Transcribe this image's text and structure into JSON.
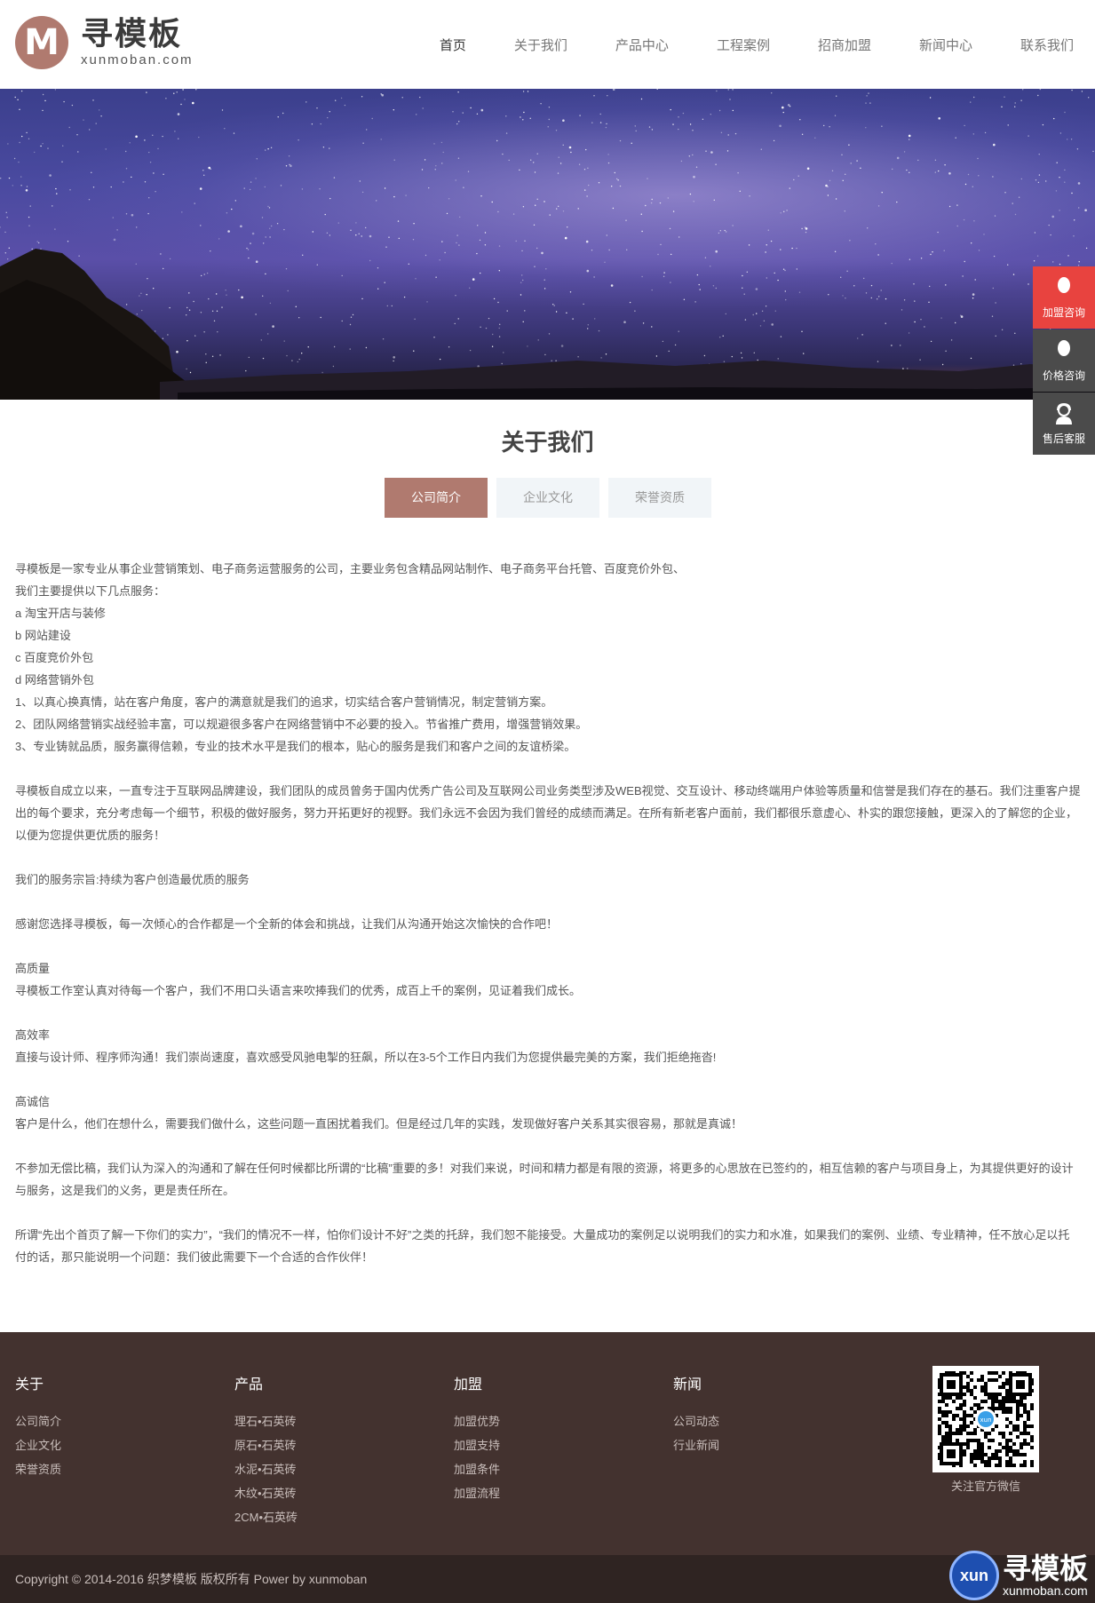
{
  "logo": {
    "mark": "M",
    "name": "寻模板",
    "domain": "xunmoban.com"
  },
  "nav": [
    "首页",
    "关于我们",
    "产品中心",
    "工程案例",
    "招商加盟",
    "新闻中心",
    "联系我们"
  ],
  "side_float": [
    "加盟咨询",
    "价格咨询",
    "售后客服"
  ],
  "about": {
    "title": "关于我们",
    "tabs": [
      "公司简介",
      "企业文化",
      "荣誉资质"
    ],
    "paragraphs": [
      "寻模板是一家专业从事企业营销策划、电子商务运营服务的公司，主要业务包含精品网站制作、电子商务平台托管、百度竞价外包、",
      "我们主要提供以下几点服务：",
      "a  淘宝开店与装修",
      "b  网站建设",
      "c  百度竞价外包",
      "d  网络营销外包",
      "1、以真心换真情，站在客户角度，客户的满意就是我们的追求，切实结合客户营销情况，制定营销方案。",
      "2、团队网络营销实战经验丰富，可以规避很多客户在网络营销中不必要的投入。节省推广费用，增强营销效果。",
      "3、专业铸就品质，服务赢得信赖，专业的技术水平是我们的根本，贴心的服务是我们和客户之间的友谊桥梁。",
      "",
      "寻模板自成立以来，一直专注于互联网品牌建设，我们团队的成员曾务于国内优秀广告公司及互联网公司业务类型涉及WEB视觉、交互设计、移动终端用户体验等质量和信誉是我们存在的基石。我们注重客户提出的每个要求，充分考虑每一个细节，积极的做好服务，努力开拓更好的视野。我们永远不会因为我们曾经的成绩而满足。在所有新老客户面前，我们都很乐意虚心、朴实的跟您接触，更深入的了解您的企业，以便为您提供更优质的服务！",
      "",
      "我们的服务宗旨:持续为客户创造最优质的服务",
      "",
      "感谢您选择寻模板，每一次倾心的合作都是一个全新的体会和挑战，让我们从沟通开始这次愉快的合作吧！",
      "",
      "高质量",
      "寻模板工作室认真对待每一个客户，我们不用口头语言来吹捧我们的优秀，成百上千的案例，见证着我们成长。",
      "",
      "高效率",
      "直接与设计师、程序师沟通！我们崇尚速度，喜欢感受风驰电掣的狂飙，所以在3-5个工作日内我们为您提供最完美的方案，我们拒绝拖沓!",
      "",
      "高诚信",
      "客户是什么，他们在想什么，需要我们做什么，这些问题一直困扰着我们。但是经过几年的实践，发现做好客户关系其实很容易，那就是真诚！",
      "",
      "不参加无偿比稿，我们认为深入的沟通和了解在任何时候都比所谓的“比稿”重要的多！对我们来说，时间和精力都是有限的资源，将更多的心思放在已签约的，相互信赖的客户与项目身上，为其提供更好的设计与服务，这是我们的义务，更是责任所在。",
      "",
      "所谓“先出个首页了解一下你们的实力”，“我们的情况不一样，怕你们设计不好”之类的托辞，我们恕不能接受。大量成功的案例足以说明我们的实力和水准，如果我们的案例、业绩、专业精神，任不放心足以托付的话，那只能说明一个问题：我们彼此需要下一个合适的合作伙伴！"
    ]
  },
  "footer": {
    "columns": [
      {
        "title": "关于",
        "links": [
          "公司简介",
          "企业文化",
          "荣誉资质"
        ]
      },
      {
        "title": "产品",
        "links": [
          "理石•石英砖",
          "原石•石英砖",
          "水泥•石英砖",
          "木纹•石英砖",
          "2CM•石英砖"
        ]
      },
      {
        "title": "加盟",
        "links": [
          "加盟优势",
          "加盟支持",
          "加盟条件",
          "加盟流程"
        ]
      },
      {
        "title": "新闻",
        "links": [
          "公司动态",
          "行业新闻"
        ]
      }
    ],
    "qr_caption": "关注官方微信",
    "qr_center": "xun"
  },
  "copyright": "Copyright © 2014-2016 织梦模板 版权所有 Power by xunmoban",
  "watermark": {
    "badge": "xun",
    "name": "寻模板",
    "domain": "xunmoban.com"
  },
  "colors": {
    "accent": "#b07a6f",
    "side_red": "#e8433f",
    "side_dark": "#4b4b4b",
    "footer_bg": "#43322f",
    "copyright_bg": "#2f2422"
  }
}
